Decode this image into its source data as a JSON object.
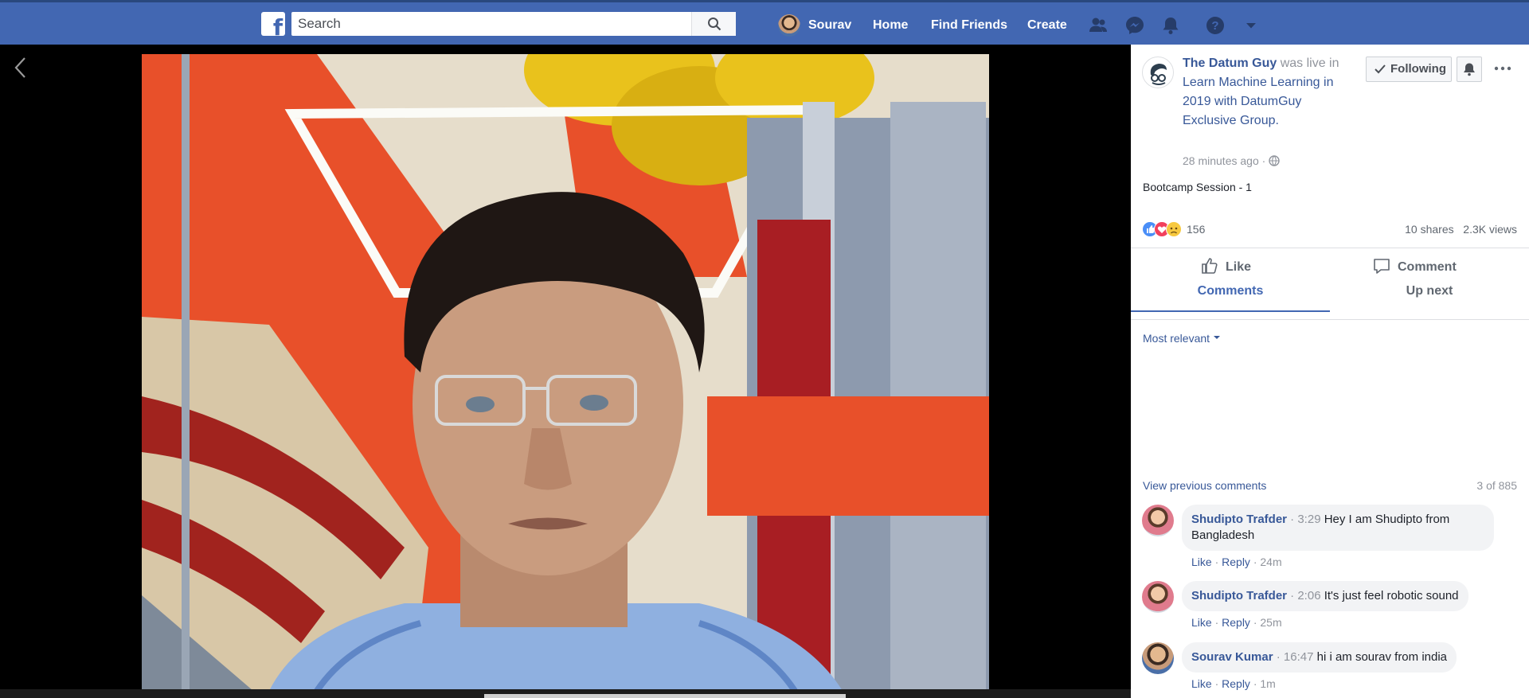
{
  "topbar": {
    "search_placeholder": "Search",
    "user_name": "Sourav",
    "nav_home": "Home",
    "nav_find_friends": "Find Friends",
    "nav_create": "Create",
    "brand_color": "#4267b2"
  },
  "post": {
    "page_name": "The Datum Guy",
    "live_text": "was live in",
    "group_name": "Learn Machine Learning in 2019 with DatumGuy Exclusive Group.",
    "time_ago": "28 minutes ago",
    "following_label": "Following",
    "title": "Bootcamp Session - 1",
    "reaction_count": "156",
    "shares": "10 shares",
    "views": "2.3K views",
    "like_label": "Like",
    "comment_label": "Comment"
  },
  "tabs": {
    "comments": "Comments",
    "up_next": "Up next"
  },
  "comments": {
    "sort_label": "Most relevant",
    "view_previous": "View previous comments",
    "count_text": "3 of 885",
    "items": [
      {
        "author": "Shudipto Trafder",
        "timestamp": "3:29",
        "text": "Hey I am Shudipto from Bangladesh",
        "like": "Like",
        "reply": "Reply",
        "age": "24m"
      },
      {
        "author": "Shudipto Trafder",
        "timestamp": "2:06",
        "text": "It's just feel robotic sound",
        "like": "Like",
        "reply": "Reply",
        "age": "25m"
      },
      {
        "author": "Sourav Kumar",
        "timestamp": "16:47",
        "text": "hi i am sourav from india",
        "like": "Like",
        "reply": "Reply",
        "age": "1m"
      }
    ]
  }
}
